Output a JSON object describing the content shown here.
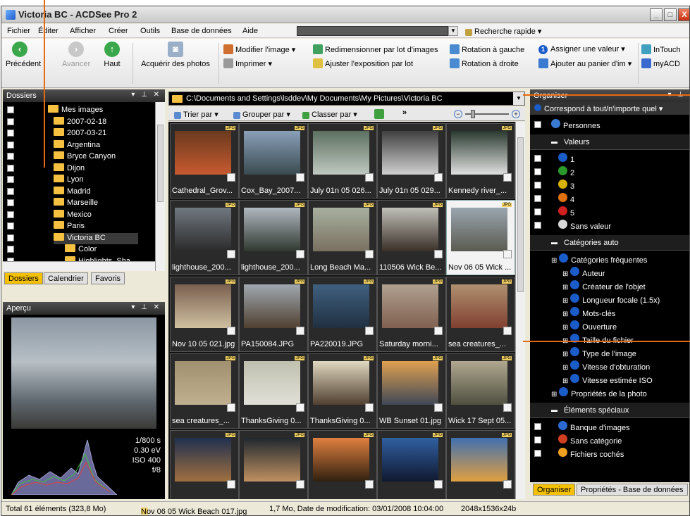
{
  "window": {
    "title": "Victoria BC - ACDSee Pro 2",
    "controls": [
      "_",
      "□",
      "X"
    ]
  },
  "menu": [
    "Fichier",
    "Éditer",
    "Afficher",
    "Créer",
    "Outils",
    "Base de données",
    "Aide"
  ],
  "quick_search": {
    "label": "Recherche rapide"
  },
  "toolbar": {
    "back": "Précédent",
    "forward": "Avancer",
    "up": "Haut",
    "acquire": "Acquérir des photos",
    "modify": "Modifier l'image",
    "print": "Imprimer",
    "batch_resize": "Redimensionner par lot d'images",
    "adjust_exposure": "Ajuster l'exposition par lot",
    "rotate_left": "Rotation à gauche",
    "rotate_right": "Rotation à droite",
    "assign_value": "Assigner une valeur",
    "add_basket": "Ajouter au panier d'im",
    "intouch": "InTouch",
    "myacd": "myACD"
  },
  "folders_panel": {
    "title": "Dossiers",
    "items": [
      {
        "label": "Mes images",
        "level": 0
      },
      {
        "label": "2007-02-18",
        "level": 1
      },
      {
        "label": "2007-03-21",
        "level": 1
      },
      {
        "label": "Argentina",
        "level": 1
      },
      {
        "label": "Bryce Canyon",
        "level": 1
      },
      {
        "label": "Dijon",
        "level": 1
      },
      {
        "label": "Lyon",
        "level": 1
      },
      {
        "label": "Madrid",
        "level": 1
      },
      {
        "label": "Marseille",
        "level": 1
      },
      {
        "label": "Mexico",
        "level": 1
      },
      {
        "label": "Paris",
        "level": 1
      },
      {
        "label": "Victoria BC",
        "level": 1
      },
      {
        "label": "Color",
        "level": 2
      },
      {
        "label": "Highlights_Sha",
        "level": 2
      }
    ],
    "tabs": [
      "Dossiers",
      "Calendrier",
      "Favoris"
    ]
  },
  "preview_panel": {
    "title": "Aperçu",
    "exif": [
      "1/800 s",
      "0.30 eV",
      "ISO 400",
      "f/8"
    ]
  },
  "browser": {
    "path": "C:\\Documents and Settings\\lsddev\\My Documents\\My Pictures\\Victoria BC",
    "sort": "Trier par",
    "group": "Grouper par",
    "classify": "Classer par",
    "more": "»",
    "thumbs": [
      {
        "cap": "Cathedral_Grov...",
        "c1": "#6a3a1e",
        "c2": "#c85a30"
      },
      {
        "cap": "Cox_Bay_2007...",
        "c1": "#8aa0b8",
        "c2": "#3a4a50"
      },
      {
        "cap": "July 01n 05 026...",
        "c1": "#5c7060",
        "c2": "#c0c8c0"
      },
      {
        "cap": "July 01n 05 029...",
        "c1": "#404040",
        "c2": "#d0d0d0"
      },
      {
        "cap": "Kennedy river_...",
        "c1": "#2a3a30",
        "c2": "#e0e0e0"
      },
      {
        "cap": "lighthouse_200...",
        "c1": "#707880",
        "c2": "#2a2a2a"
      },
      {
        "cap": "lighthouse_200...",
        "c1": "#b0b8c0",
        "c2": "#303830"
      },
      {
        "cap": "Long Beach Ma...",
        "c1": "#a8b0a0",
        "c2": "#7a7060"
      },
      {
        "cap": "110506 Wick Be...",
        "c1": "#c0c0b8",
        "c2": "#3a3028"
      },
      {
        "cap": "Nov 06 05 Wick ...",
        "c1": "#9aa6b0",
        "c2": "#5a5a50"
      },
      {
        "cap": "Nov 10 05 021.jpg",
        "c1": "#7a6050",
        "c2": "#d0c0a0"
      },
      {
        "cap": "PA150084.JPG",
        "c1": "#a0a8b0",
        "c2": "#504030"
      },
      {
        "cap": "PA220019.JPG",
        "c1": "#406080",
        "c2": "#203040"
      },
      {
        "cap": "Saturday morni...",
        "c1": "#b0a090",
        "c2": "#806050"
      },
      {
        "cap": "sea creatures_...",
        "c1": "#b09070",
        "c2": "#804030"
      },
      {
        "cap": "sea creatures_...",
        "c1": "#a09070",
        "c2": "#c0b090"
      },
      {
        "cap": "ThanksGiving 0...",
        "c1": "#c0c0b0",
        "c2": "#e0e0d8"
      },
      {
        "cap": "ThanksGiving 0...",
        "c1": "#e0d8c0",
        "c2": "#504030"
      },
      {
        "cap": "WB Sunset 01.jpg",
        "c1": "#e0a050",
        "c2": "#404858"
      },
      {
        "cap": "Wick 17 Sept 05...",
        "c1": "#b0a890",
        "c2": "#505040"
      },
      {
        "cap": "",
        "c1": "#203050",
        "c2": "#a07040"
      },
      {
        "cap": "",
        "c1": "#202830",
        "c2": "#c09060"
      },
      {
        "cap": "",
        "c1": "#e08040",
        "c2": "#302010"
      },
      {
        "cap": "",
        "c1": "#3060a0",
        "c2": "#101830"
      },
      {
        "cap": "",
        "c1": "#4070b0",
        "c2": "#e0a040"
      }
    ]
  },
  "organize_panel": {
    "title": "Organiser",
    "match": "Correspond à tout/n'importe quel",
    "people": "Personnes",
    "values_header": "Valeurs",
    "values": [
      {
        "label": "1",
        "color": "#1a5cc8"
      },
      {
        "label": "2",
        "color": "#2a9a2a"
      },
      {
        "label": "3",
        "color": "#d8b000"
      },
      {
        "label": "4",
        "color": "#e07010"
      },
      {
        "label": "5",
        "color": "#d02020"
      },
      {
        "label": "Sans valeur",
        "color": "#d8d8d8"
      }
    ],
    "auto_header": "Catégories auto",
    "frequent": "Catégories fréquentes",
    "auto_items": [
      "Auteur",
      "Créateur de l'objet",
      "Longueur focale (1.5x)",
      "Mots-clés",
      "Ouverture",
      "Taille du fichier",
      "Type de l'image",
      "Vitesse d'obturation",
      "Vitesse estimée ISO"
    ],
    "photo_props": "Propriétés de la photo",
    "special_header": "Éléments spéciaux",
    "special_items": [
      "Banque d'images",
      "Sans catégorie",
      "Fichiers cochés"
    ],
    "tabs": [
      "Organiser",
      "Propriétés - Base de données"
    ]
  },
  "status": {
    "total": "Total 61 éléments  (323,8 Mo)",
    "file": "Nov 06 05 Wick Beach 017.jpg",
    "info": "1,7 Mo, Date de modification: 03/01/2008 10:04:00",
    "dims": "2048x1536x24b"
  },
  "colors": {
    "accent": "#f4c000",
    "callout": "#e86a10"
  }
}
